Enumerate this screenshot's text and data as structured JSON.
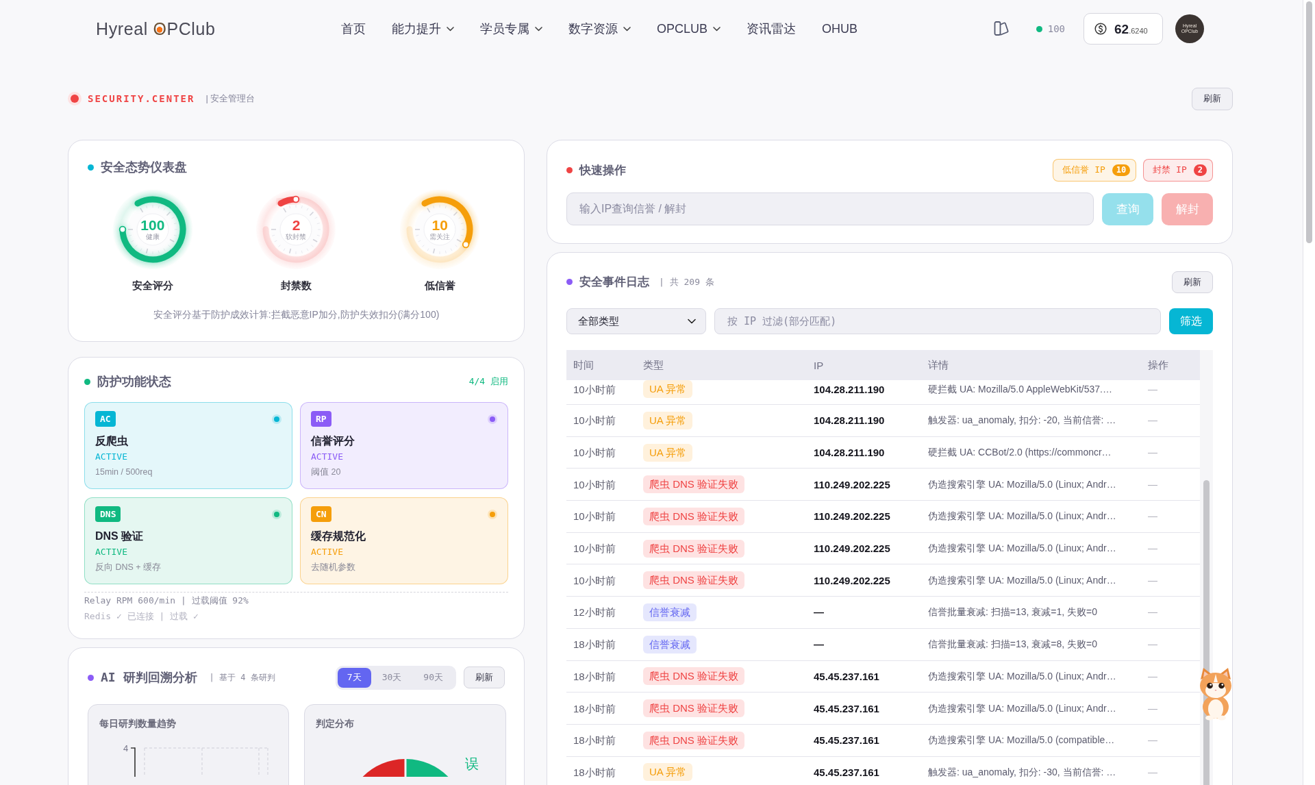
{
  "header": {
    "logo": {
      "name": "Hyreal",
      "mark": "O",
      "rest": "PClub"
    },
    "nav": [
      {
        "label": "首页",
        "dropdown": false
      },
      {
        "label": "能力提升",
        "dropdown": true
      },
      {
        "label": "学员专属",
        "dropdown": true
      },
      {
        "label": "数字资源",
        "dropdown": true
      },
      {
        "label": "OPCLUB",
        "dropdown": true
      },
      {
        "label": "资讯雷达",
        "dropdown": false
      },
      {
        "label": "OHUB",
        "dropdown": false
      }
    ],
    "points": "100",
    "balance": {
      "whole": "62",
      "fraction": ".6240"
    },
    "avatar": [
      "Hyreal",
      "OPClub"
    ]
  },
  "security_bar": {
    "title": "SECURITY.CENTER",
    "subtitle": "| 安全管理台",
    "refresh": "刷新"
  },
  "dashboard": {
    "title": "安全态势仪表盘",
    "gauges": [
      {
        "value": "100",
        "caption": "健康",
        "label": "安全评分",
        "level": 1,
        "color": "#10b981"
      },
      {
        "value": "2",
        "caption": "软封禁",
        "label": "封禁数",
        "level": 0.1,
        "color": "#ef4444"
      },
      {
        "value": "10",
        "caption": "需关注",
        "label": "低信誉",
        "level": 0.5,
        "color": "#f59e0b"
      }
    ],
    "note": "安全评分基于防护成效计算:拦截恶意IP加分,防护失效扣分(满分100)"
  },
  "protection": {
    "title": "防护功能状态",
    "summary": "4/4 启用",
    "features": [
      {
        "code": "AC",
        "name": "反爬虫",
        "status": "ACTIVE",
        "detail": "15min / 500req",
        "color": "#06b6d4"
      },
      {
        "code": "RP",
        "name": "信誉评分",
        "status": "ACTIVE",
        "detail": "阈值 20",
        "color": "#8b5cf6"
      },
      {
        "code": "DNS",
        "name": "DNS 验证",
        "status": "ACTIVE",
        "detail": "反向 DNS + 缓存",
        "color": "#10b981"
      },
      {
        "code": "CN",
        "name": "缓存规范化",
        "status": "ACTIVE",
        "detail": "去随机参数",
        "color": "#f59e0b"
      }
    ],
    "footer": [
      "Relay RPM 600/min | 过载阈值 92%",
      "Redis ✓ 已连接 | 过载 ✓"
    ]
  },
  "ai_analysis": {
    "title": "AI 研判回溯分析",
    "subtitle": "| 基于 4 条研判",
    "ranges": [
      {
        "label": "7天",
        "selected": true
      },
      {
        "label": "30天",
        "selected": false
      },
      {
        "label": "90天",
        "selected": false
      }
    ],
    "refresh": "刷新",
    "trend": {
      "title": "每日研判数量趋势",
      "y_tick": "4"
    },
    "distribution": {
      "title": "判定分布",
      "label": "误"
    }
  },
  "quick_actions": {
    "title": "快速操作",
    "badges": [
      {
        "label": "低信誉 IP",
        "count": "10",
        "color": "#f59e0b"
      },
      {
        "label": "封禁 IP",
        "count": "2",
        "color": "#ef4444"
      }
    ],
    "search": {
      "placeholder": "输入IP查询信誉 / 解封"
    },
    "buttons": [
      {
        "label": "查询",
        "kind": "query",
        "disabled": true
      },
      {
        "label": "解封",
        "kind": "unban",
        "disabled": true
      }
    ]
  },
  "event_log": {
    "title": "安全事件日志",
    "count": "| 共 209 条",
    "refresh": "刷新",
    "type_filter": {
      "value": "全部类型"
    },
    "ip_filter": {
      "placeholder": "按 IP 过滤(部分匹配)"
    },
    "filter_button": "筛选",
    "table": {
      "columns": [
        "时间",
        "类型",
        "IP",
        "详情",
        "操作"
      ],
      "rows": [
        {
          "time": "10小时前",
          "type": {
            "label": "UA 异常",
            "kind": "ua"
          },
          "ip": "104.28.211.190",
          "detail": "硬拦截 UA: Mozilla/5.0 AppleWebKit/537.…",
          "action": "—"
        },
        {
          "time": "10小时前",
          "type": {
            "label": "UA 异常",
            "kind": "ua"
          },
          "ip": "104.28.211.190",
          "detail": "触发器: ua_anomaly, 扣分: -20, 当前信誉: …",
          "action": "—"
        },
        {
          "time": "10小时前",
          "type": {
            "label": "UA 异常",
            "kind": "ua"
          },
          "ip": "104.28.211.190",
          "detail": "硬拦截 UA: CCBot/2.0 (https://commoncr…",
          "action": "—"
        },
        {
          "time": "10小时前",
          "type": {
            "label": "爬虫 DNS 验证失败",
            "kind": "dns_fail"
          },
          "ip": "110.249.202.225",
          "detail": "伪造搜索引擎 UA: Mozilla/5.0 (Linux; Andr…",
          "action": "—"
        },
        {
          "time": "10小时前",
          "type": {
            "label": "爬虫 DNS 验证失败",
            "kind": "dns_fail"
          },
          "ip": "110.249.202.225",
          "detail": "伪造搜索引擎 UA: Mozilla/5.0 (Linux; Andr…",
          "action": "—"
        },
        {
          "time": "10小时前",
          "type": {
            "label": "爬虫 DNS 验证失败",
            "kind": "dns_fail"
          },
          "ip": "110.249.202.225",
          "detail": "伪造搜索引擎 UA: Mozilla/5.0 (Linux; Andr…",
          "action": "—"
        },
        {
          "time": "10小时前",
          "type": {
            "label": "爬虫 DNS 验证失败",
            "kind": "dns_fail"
          },
          "ip": "110.249.202.225",
          "detail": "伪造搜索引擎 UA: Mozilla/5.0 (Linux; Andr…",
          "action": "—"
        },
        {
          "time": "12小时前",
          "type": {
            "label": "信誉衰减",
            "kind": "decay"
          },
          "ip": "—",
          "detail": "信誉批量衰减: 扫描=13, 衰减=1, 失败=0",
          "action": "—"
        },
        {
          "time": "18小时前",
          "type": {
            "label": "信誉衰减",
            "kind": "decay"
          },
          "ip": "—",
          "detail": "信誉批量衰减: 扫描=13, 衰减=8, 失败=0",
          "action": "—"
        },
        {
          "time": "18小时前",
          "type": {
            "label": "爬虫 DNS 验证失败",
            "kind": "dns_fail"
          },
          "ip": "45.45.237.161",
          "detail": "伪造搜索引擎 UA: Mozilla/5.0 (Linux; Andr…",
          "action": "—"
        },
        {
          "time": "18小时前",
          "type": {
            "label": "爬虫 DNS 验证失败",
            "kind": "dns_fail"
          },
          "ip": "45.45.237.161",
          "detail": "伪造搜索引擎 UA: Mozilla/5.0 (Linux; Andr…",
          "action": "—"
        },
        {
          "time": "18小时前",
          "type": {
            "label": "爬虫 DNS 验证失败",
            "kind": "dns_fail"
          },
          "ip": "45.45.237.161",
          "detail": "伪造搜索引擎 UA: Mozilla/5.0 (compatible…",
          "action": "—"
        },
        {
          "time": "18小时前",
          "type": {
            "label": "UA 异常",
            "kind": "ua"
          },
          "ip": "45.45.237.161",
          "detail": "触发器: ua_anomaly, 扣分: -30, 当前信誉: …",
          "action": "—"
        }
      ]
    }
  }
}
